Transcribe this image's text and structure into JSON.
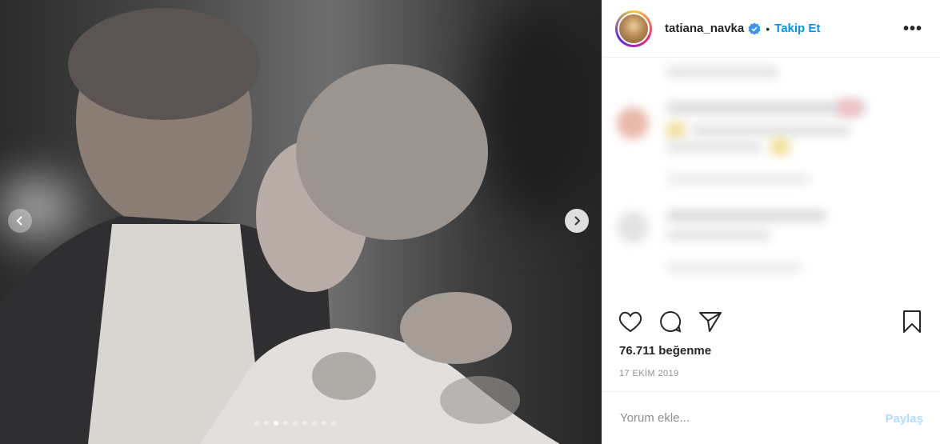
{
  "post_header": {
    "username": "tatiana_navka",
    "separator": "•",
    "follow_label": "Takip Et",
    "more_label": "•••"
  },
  "photo": {
    "description_icon": "couple-photo",
    "carousel_count": 9,
    "carousel_active_index": 2
  },
  "actions": {
    "icons": [
      "heart-icon",
      "comment-icon",
      "share-icon",
      "bookmark-icon"
    ]
  },
  "stats": {
    "likes_text": "76.711 beğenme",
    "date_text": "17 EKİM 2019"
  },
  "comment_box": {
    "placeholder": "Yorum ekle...",
    "post_label": "Paylaş"
  },
  "colors": {
    "accent": "#0095f6",
    "post_disabled": "#b3dbff",
    "text": "#262626",
    "muted": "#8e8e8e"
  }
}
